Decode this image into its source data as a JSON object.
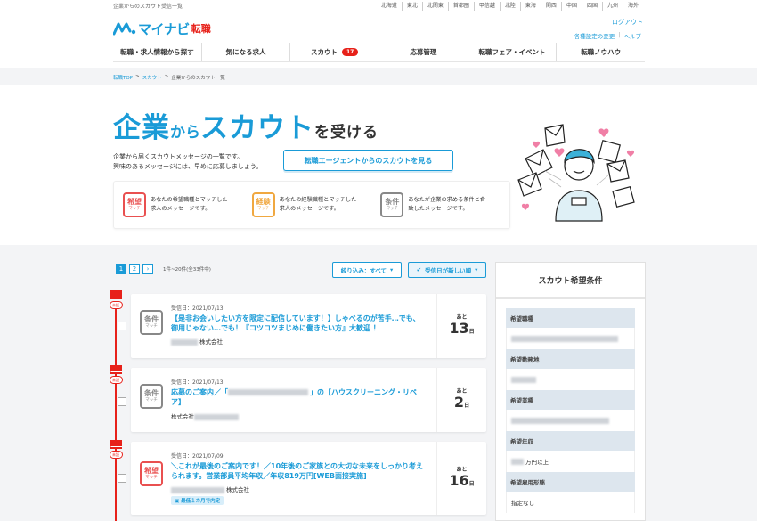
{
  "topbar": {
    "tagline": "企業からのスカウト受信一覧",
    "regions": [
      "北海道",
      "東北",
      "北関東",
      "首都圏",
      "甲信越",
      "北陸",
      "東海",
      "関西",
      "中国",
      "四国",
      "九州",
      "海外"
    ]
  },
  "header": {
    "logo_text": "マイナビ",
    "logo_sub": "転職",
    "logout": "ログアウト",
    "settings_change": "各種設定の変更",
    "help": "ヘルプ"
  },
  "nav": {
    "items": [
      "転職・求人情報から探す",
      "気になる求人",
      "スカウト",
      "応募管理",
      "転職フェア・イベント",
      "転職ノウハウ"
    ],
    "scout_badge": "17"
  },
  "breadcrumb": {
    "top": "転職TOP",
    "scout": "スカウト",
    "current": "企業からのスカウト一覧",
    "sep": ">"
  },
  "hero": {
    "t1": "企業",
    "t2": "から",
    "t3": "スカウト",
    "t4": "を受ける",
    "desc1": "企業から届くスカウトメッセージの一覧です。",
    "desc2": "興味のあるメッセージには、早めに応募しましょう。",
    "agent_button": "転職エージェントからのスカウトを見る"
  },
  "legend": [
    {
      "b1": "希望",
      "b2": "マッチ",
      "color": "#e95050",
      "text1": "あなたの希望職種とマッチした",
      "text2": "求人のメッセージです。"
    },
    {
      "b1": "経験",
      "b2": "マッチ",
      "color": "#f0a840",
      "text1": "あなたの経験職種とマッチした",
      "text2": "求人のメッセージです。"
    },
    {
      "b1": "条件",
      "b2": "マッチ",
      "color": "#888888",
      "text1": "あなたが企業の求める条件と合",
      "text2": "致したメッセージです。"
    }
  ],
  "pager": {
    "pages": [
      "1",
      "2",
      "›"
    ],
    "info": "1件~20件(全33件中)"
  },
  "filter": {
    "filter_label": "絞り込み：すべて",
    "sort_label": "受信日が新しい順"
  },
  "cards": [
    {
      "unread": "未読",
      "badge_b1": "条件",
      "badge_b2": "マッチ",
      "date": "受信日：2021/07/13",
      "title": "【是非お会いしたい方を限定に配信しています！】しゃべるのが苦手…でも、御用じゃない…でも！『コツコツまじめに働きたい方』大歓迎 ！",
      "company": "株式会社",
      "remain_pre": "あと",
      "remain_num": "13",
      "remain_unit": "日"
    },
    {
      "unread": "未読",
      "badge_b1": "条件",
      "badge_b2": "マッチ",
      "date": "受信日：2021/07/13",
      "title": "応募のご案内／「",
      "title2": "」の【ハウスクリーニング・リペア】",
      "company": "株式会社",
      "remain_pre": "あと",
      "remain_num": "2",
      "remain_unit": "日"
    },
    {
      "unread": "未読",
      "badge_b1": "希望",
      "badge_b2": "マッチ",
      "date": "受信日：2021/07/09",
      "title": "＼これが最後のご案内です！／10年後のご家族との大切な未来をしっかり考えられます。営業部員平均年収／年収819万円[WEB面接実施]",
      "company": "株式会社",
      "tag": "最低１カ月で内定",
      "remain_pre": "あと",
      "remain_num": "16",
      "remain_unit": "日"
    }
  ],
  "sidebar": {
    "title": "スカウト希望条件",
    "rows": [
      {
        "label": "希望職種",
        "value": ""
      },
      {
        "label": "希望勤務地",
        "value": ""
      },
      {
        "label": "希望業種",
        "value": ""
      },
      {
        "label": "希望年収",
        "value": "万円以上"
      },
      {
        "label": "希望雇用形態",
        "value": "指定なし"
      }
    ]
  }
}
